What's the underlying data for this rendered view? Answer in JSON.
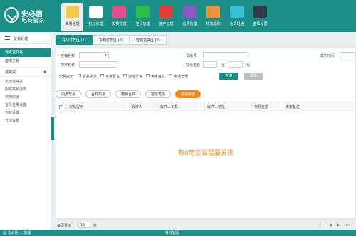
{
  "brand": {
    "name": "安必信",
    "subtitle": "电商管家"
  },
  "nav": [
    {
      "label": "交易处理",
      "icon": "transaction-icon",
      "color": "#f2c94c"
    },
    {
      "label": "打印管理",
      "icon": "printer-icon",
      "color": "#ffffff"
    },
    {
      "label": "发货管理",
      "icon": "shipping-icon",
      "color": "#e84c8b"
    },
    {
      "label": "宝贝管理",
      "icon": "product-box-icon",
      "color": "#2bbf4a"
    },
    {
      "label": "客户管理",
      "icon": "customer-icon",
      "color": "#e83b3b"
    },
    {
      "label": "运费管理",
      "icon": "calculator-icon",
      "color": "#8a5cc2"
    },
    {
      "label": "物流跟踪",
      "icon": "tracking-icon",
      "color": "#f2913c"
    },
    {
      "label": "免费短信",
      "icon": "sms-icon",
      "color": "#35c0d8"
    },
    {
      "label": "基础设置",
      "icon": "gear-icon",
      "color": "#2f3b48"
    }
  ],
  "sidebar": {
    "title": "交易处理",
    "items": [
      "待发货交易",
      "虚拟交易"
    ],
    "group": "退换货",
    "sub_items": [
      "集运退换货",
      "跟踪高频退单",
      "常用快递",
      "宝贝重量设置",
      "包材设置",
      "仓库设置"
    ]
  },
  "tabs": [
    "在线付款区 (0)",
    "货到付款区 (0)",
    "智能发货区 (0)"
  ],
  "filter": {
    "shop_label": "店铺名称",
    "trade_no_label": "交易号",
    "deal_time_label": "成交时间",
    "buyer_nick_label": "买家昵称",
    "amount_label": "交易金额",
    "amount_to": "至",
    "amount_unit": "元",
    "hint_label": "交易提示：",
    "hints": [
      "合并发货",
      "买家留言",
      "地址异常",
      "卖家备注",
      "电话错误"
    ],
    "search_label": "查询",
    "reset_label": "重置"
  },
  "actions": [
    "同步交易",
    "合并交易",
    "撤销合并",
    "智能发货",
    "添加快递"
  ],
  "table": {
    "columns": [
      "交易提示",
      "收件人",
      "收件人手机",
      "收件人地址",
      "交易金额",
      "卖家备注"
    ],
    "empty_message": "有0笔交易需要发货"
  },
  "pager": {
    "per_page_label": "每页显示",
    "per_page_value": "15",
    "unit": "条"
  },
  "statusbar": {
    "left": "@ 安必信 ... 客服",
    "center": "在线客服"
  }
}
